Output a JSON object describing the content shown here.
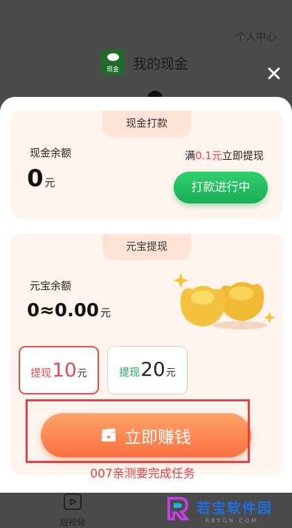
{
  "background": {
    "top_link": "个人中心",
    "title": "我的现金",
    "wallet_icon_text": "现金"
  },
  "cash_card": {
    "tab_label": "现金打款",
    "balance_label": "现金余额",
    "balance_value": "0",
    "balance_unit": "元",
    "condition_prefix": "满",
    "condition_amount": "0.1元",
    "condition_suffix": "立即提现",
    "button_label": "打款进行中"
  },
  "yuanbao_card": {
    "tab_label": "元宝提现",
    "balance_label": "元宝余额",
    "balance_value": "0≈0.00",
    "balance_unit": "元",
    "options": [
      {
        "prefix": "提现",
        "amount": "10",
        "unit": "元"
      },
      {
        "prefix": "提现",
        "amount": "20",
        "unit": "元"
      }
    ],
    "earn_button_label": "立即赚钱"
  },
  "note": "007亲测要完成任务",
  "bottom_nav": {
    "video_label": "短视频"
  },
  "brand": {
    "name": "若宝软件园",
    "sub": "RBSGN.COM"
  },
  "colors": {
    "accent_green": "#1aae55",
    "accent_orange": "#fb7040",
    "highlight_red": "#f04040"
  }
}
